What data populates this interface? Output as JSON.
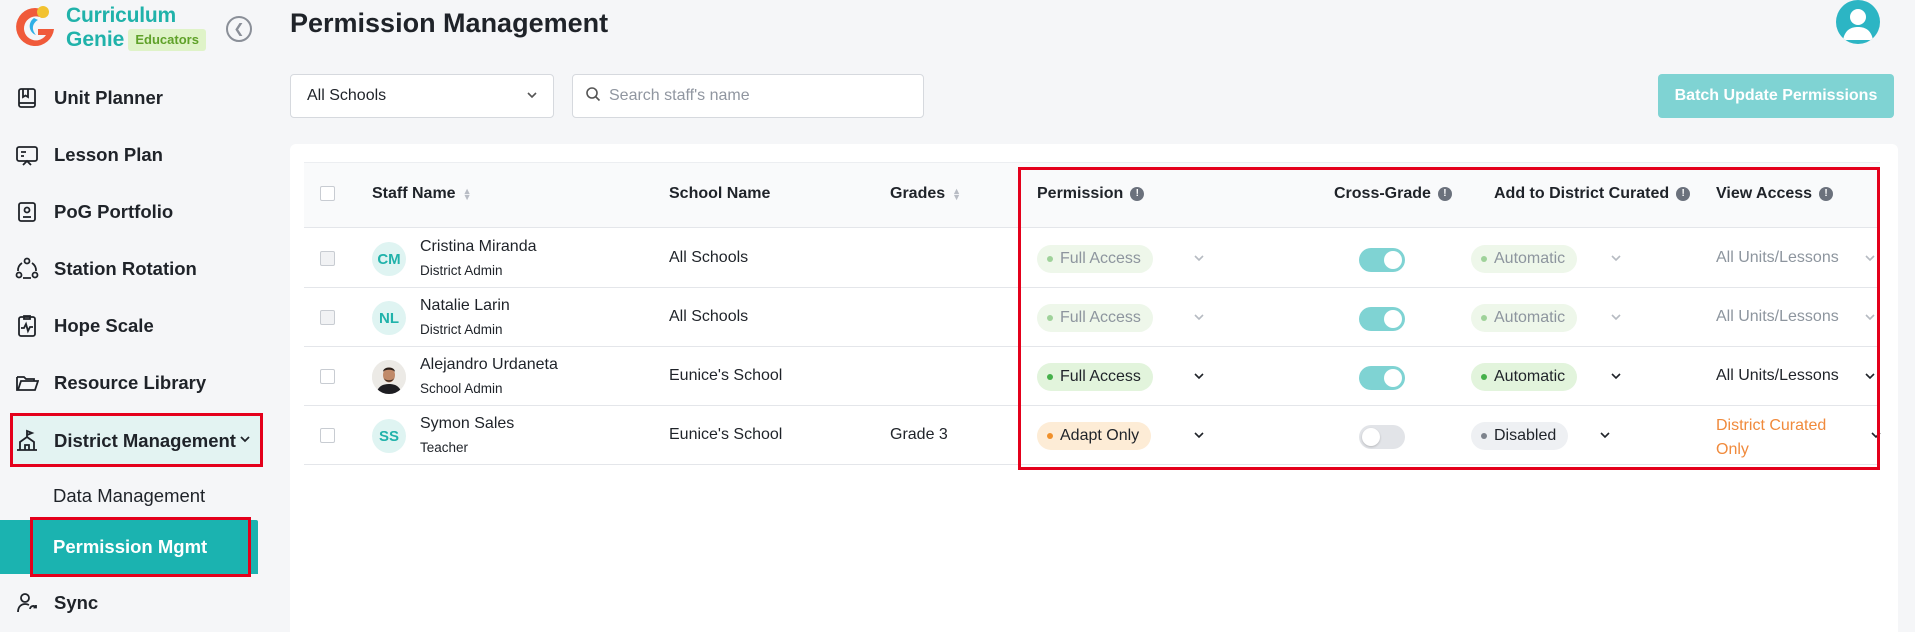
{
  "brand": {
    "line1": "Curriculum",
    "line2": "Genie",
    "badge": "Educators"
  },
  "sidebar": {
    "items": [
      {
        "label": "Unit Planner",
        "icon": "book-icon"
      },
      {
        "label": "Lesson Plan",
        "icon": "lesson-icon"
      },
      {
        "label": "PoG Portfolio",
        "icon": "portfolio-icon"
      },
      {
        "label": "Station Rotation",
        "icon": "rotation-icon"
      },
      {
        "label": "Hope Scale",
        "icon": "pulse-icon"
      },
      {
        "label": "Resource Library",
        "icon": "folder-icon"
      },
      {
        "label": "District Management",
        "icon": "district-icon"
      },
      {
        "label": "Sync",
        "icon": "sync-icon"
      }
    ],
    "sub_items": [
      {
        "label": "Data Management"
      },
      {
        "label": "Permission Mgmt"
      }
    ]
  },
  "header": {
    "title": "Permission Management"
  },
  "filters": {
    "school": "All Schools",
    "search_placeholder": "Search staff's name",
    "batch_button": "Batch Update Permissions"
  },
  "table": {
    "columns": {
      "staff_name": "Staff Name",
      "school_name": "School Name",
      "grades": "Grades",
      "permission": "Permission",
      "cross_grade": "Cross-Grade",
      "add_district": "Add to District Curated",
      "view_access": "View Access"
    },
    "rows": [
      {
        "initials": "CM",
        "name": "Cristina Miranda",
        "role": "District Admin",
        "school": "All Schools",
        "grade": "",
        "permission": "Full Access",
        "cross_grade": true,
        "curated": "Automatic",
        "view_access": "All Units/Lessons",
        "disabled": true
      },
      {
        "initials": "NL",
        "name": "Natalie Larin",
        "role": "District Admin",
        "school": "All Schools",
        "grade": "",
        "permission": "Full Access",
        "cross_grade": true,
        "curated": "Automatic",
        "view_access": "All Units/Lessons",
        "disabled": true
      },
      {
        "initials": "",
        "name": "Alejandro Urdaneta",
        "role": "School Admin",
        "school": "Eunice's School",
        "grade": "",
        "permission": "Full Access",
        "cross_grade": true,
        "curated": "Automatic",
        "view_access": "All Units/Lessons",
        "disabled": false
      },
      {
        "initials": "SS",
        "name": "Symon Sales",
        "role": "Teacher",
        "school": "Eunice's School",
        "grade": "Grade 3",
        "permission": "Adapt Only",
        "cross_grade": false,
        "curated": "Disabled",
        "view_access_line1": "District Curated",
        "view_access_line2": "Only",
        "disabled": false
      }
    ]
  },
  "colors": {
    "brand": "#20b2aa",
    "accent_red": "#e4001b",
    "orange_text": "#f08a3c"
  }
}
